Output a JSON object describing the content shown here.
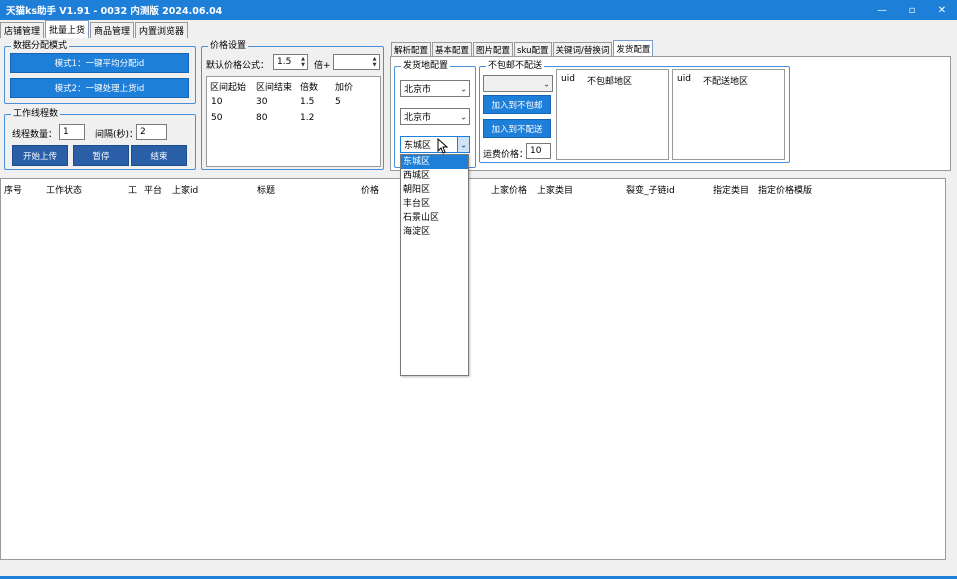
{
  "window": {
    "title": "天猫ks助手 V1.91 - 0032 内测版 2024.06.04",
    "min_glyph": "—",
    "max_glyph": "▫",
    "close_glyph": "✕"
  },
  "main_tabs": [
    {
      "label": "店铺管理",
      "active": false
    },
    {
      "label": "批量上货",
      "active": true
    },
    {
      "label": "商品管理",
      "active": false
    },
    {
      "label": "内置浏览器",
      "active": false
    }
  ],
  "data_mode": {
    "legend": "数据分配模式",
    "mode1_label": "模式1：一键平均分配id",
    "mode2_label": "模式2：一键处理上货id"
  },
  "work_threads": {
    "legend": "工作线程数",
    "thread_count_label": "线程数量：",
    "thread_count_value": "1",
    "interval_label": "间隔(秒)：",
    "interval_value": "2",
    "start_label": "开始上传",
    "pause_label": "暂停",
    "stop_label": "结束"
  },
  "price_settings": {
    "legend": "价格设置",
    "formula_label": "默认价格公式：",
    "multiplier_value": "1.5",
    "times_plus_label": "倍+",
    "add_value": "",
    "columns": [
      "区间起始",
      "区间结束",
      "倍数",
      "加价"
    ],
    "rows": [
      [
        "10",
        "30",
        "1.5",
        "5"
      ],
      [
        "50",
        "80",
        "1.2",
        ""
      ]
    ]
  },
  "sub_tabs": [
    {
      "label": "解析配置",
      "active": false
    },
    {
      "label": "基本配置",
      "active": false
    },
    {
      "label": "图片配置",
      "active": false
    },
    {
      "label": "sku配置",
      "active": false
    },
    {
      "label": "关键词/替换词",
      "active": false
    },
    {
      "label": "发货配置",
      "active": true
    }
  ],
  "ship_from": {
    "legend": "发货地配置",
    "province": "北京市",
    "city": "北京市",
    "district": "东城区",
    "district_options": [
      "东城区",
      "西城区",
      "朝阳区",
      "丰台区",
      "石景山区",
      "海淀区"
    ],
    "selected_option_index": 0
  },
  "no_free_shipping": {
    "legend": "不包邮不配送",
    "region_select": "",
    "add_no_free_label": "加入到不包邮",
    "add_no_delivery_label": "加入到不配送",
    "shipping_fee_label": "运费价格：",
    "shipping_fee_value": "10",
    "list1_headers": [
      "uid",
      "不包邮地区"
    ],
    "list2_headers": [
      "uid",
      "不配送地区"
    ]
  },
  "main_table": {
    "headers": [
      "序号",
      "工作状态",
      "工",
      "平台",
      "上家id",
      "标题",
      "价格",
      "上家价格",
      "上家类目",
      "裂变_子链id",
      "指定类目",
      "指定价格模版"
    ]
  }
}
